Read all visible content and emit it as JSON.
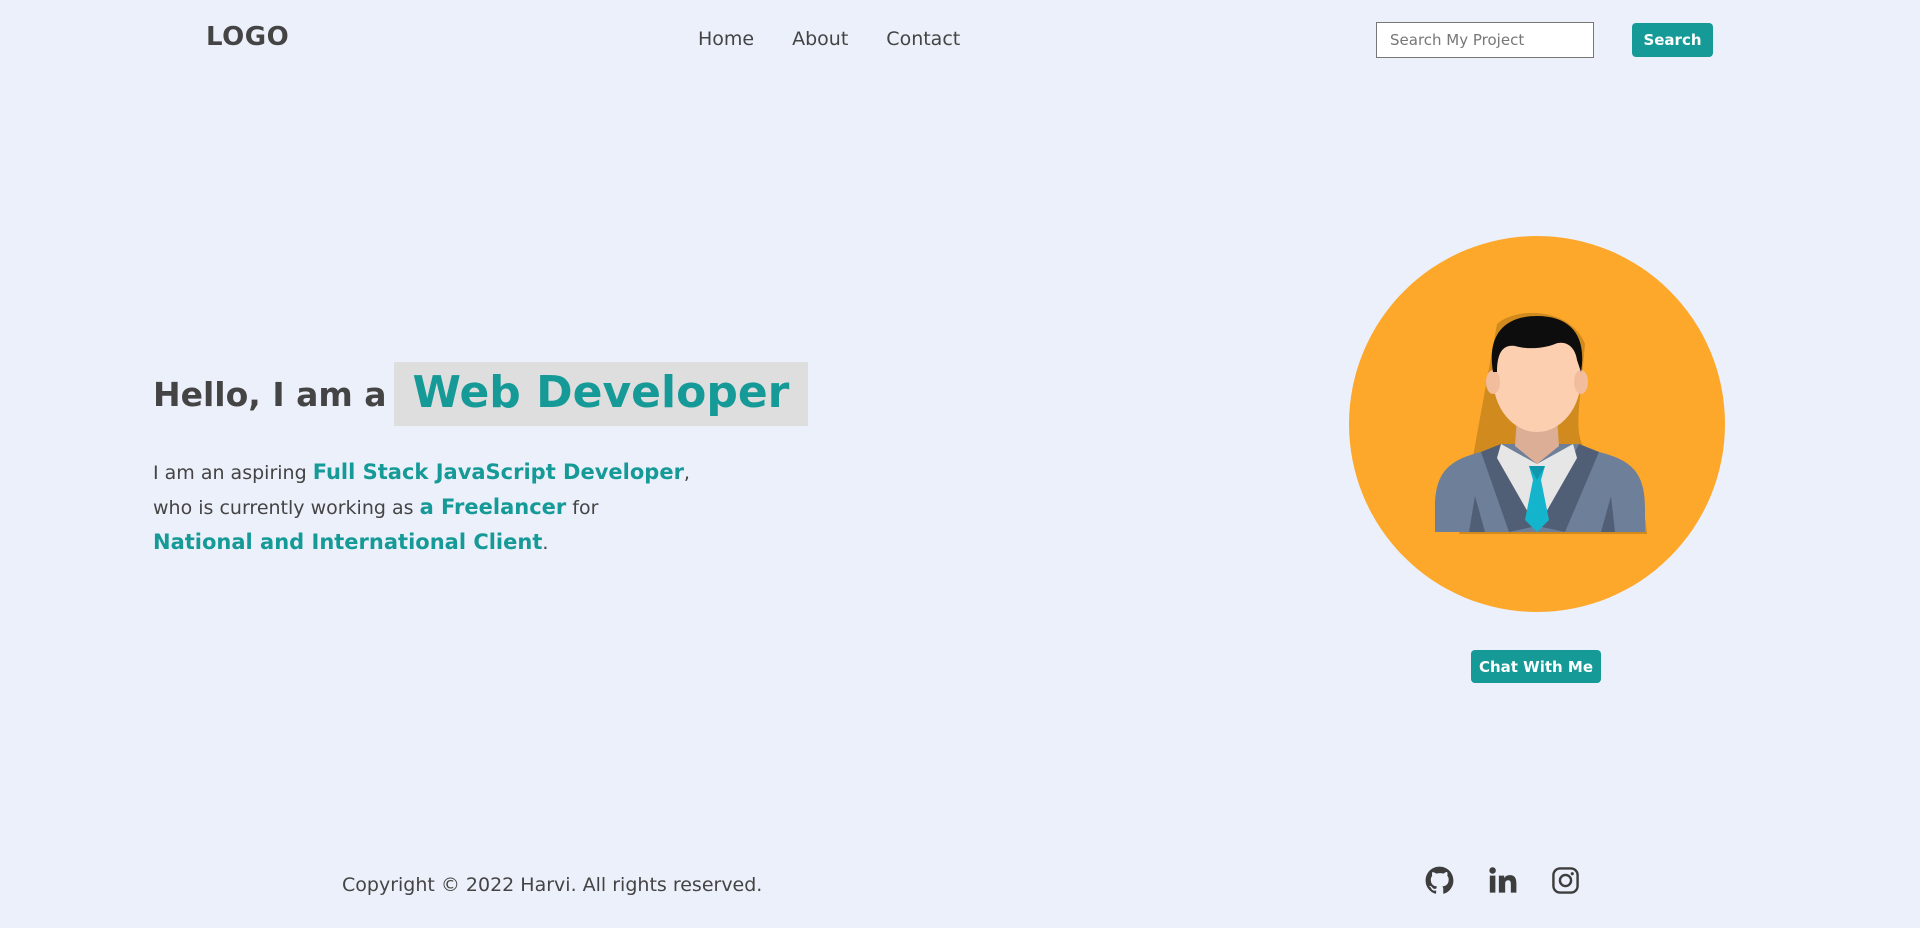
{
  "header": {
    "logo": "LOGO",
    "nav": [
      {
        "label": "Home"
      },
      {
        "label": "About"
      },
      {
        "label": "Contact"
      }
    ],
    "search": {
      "placeholder": "Search My Project",
      "value": "",
      "button_label": "Search"
    }
  },
  "hero": {
    "greeting": "Hello, I am a",
    "role": "Web Developer",
    "bio": {
      "part1": "I am an aspiring ",
      "highlight1": "Full Stack JavaScript Developer",
      "part2": ",",
      "part3": "who is currently working as ",
      "highlight2": "a Freelancer",
      "part4": " for",
      "highlight3": "National and International Client",
      "part5": "."
    },
    "chat_button_label": "Chat With Me",
    "avatar_icon": "businessman-avatar-icon"
  },
  "footer": {
    "copyright": "Copyright © 2022 Harvi. All rights reserved.",
    "social": [
      {
        "icon": "github-icon"
      },
      {
        "icon": "linkedin-icon"
      },
      {
        "icon": "instagram-icon"
      }
    ]
  },
  "colors": {
    "background": "#ecf0fb",
    "accent": "#159a97",
    "avatar_circle": "#fda82a",
    "text": "#444444"
  }
}
